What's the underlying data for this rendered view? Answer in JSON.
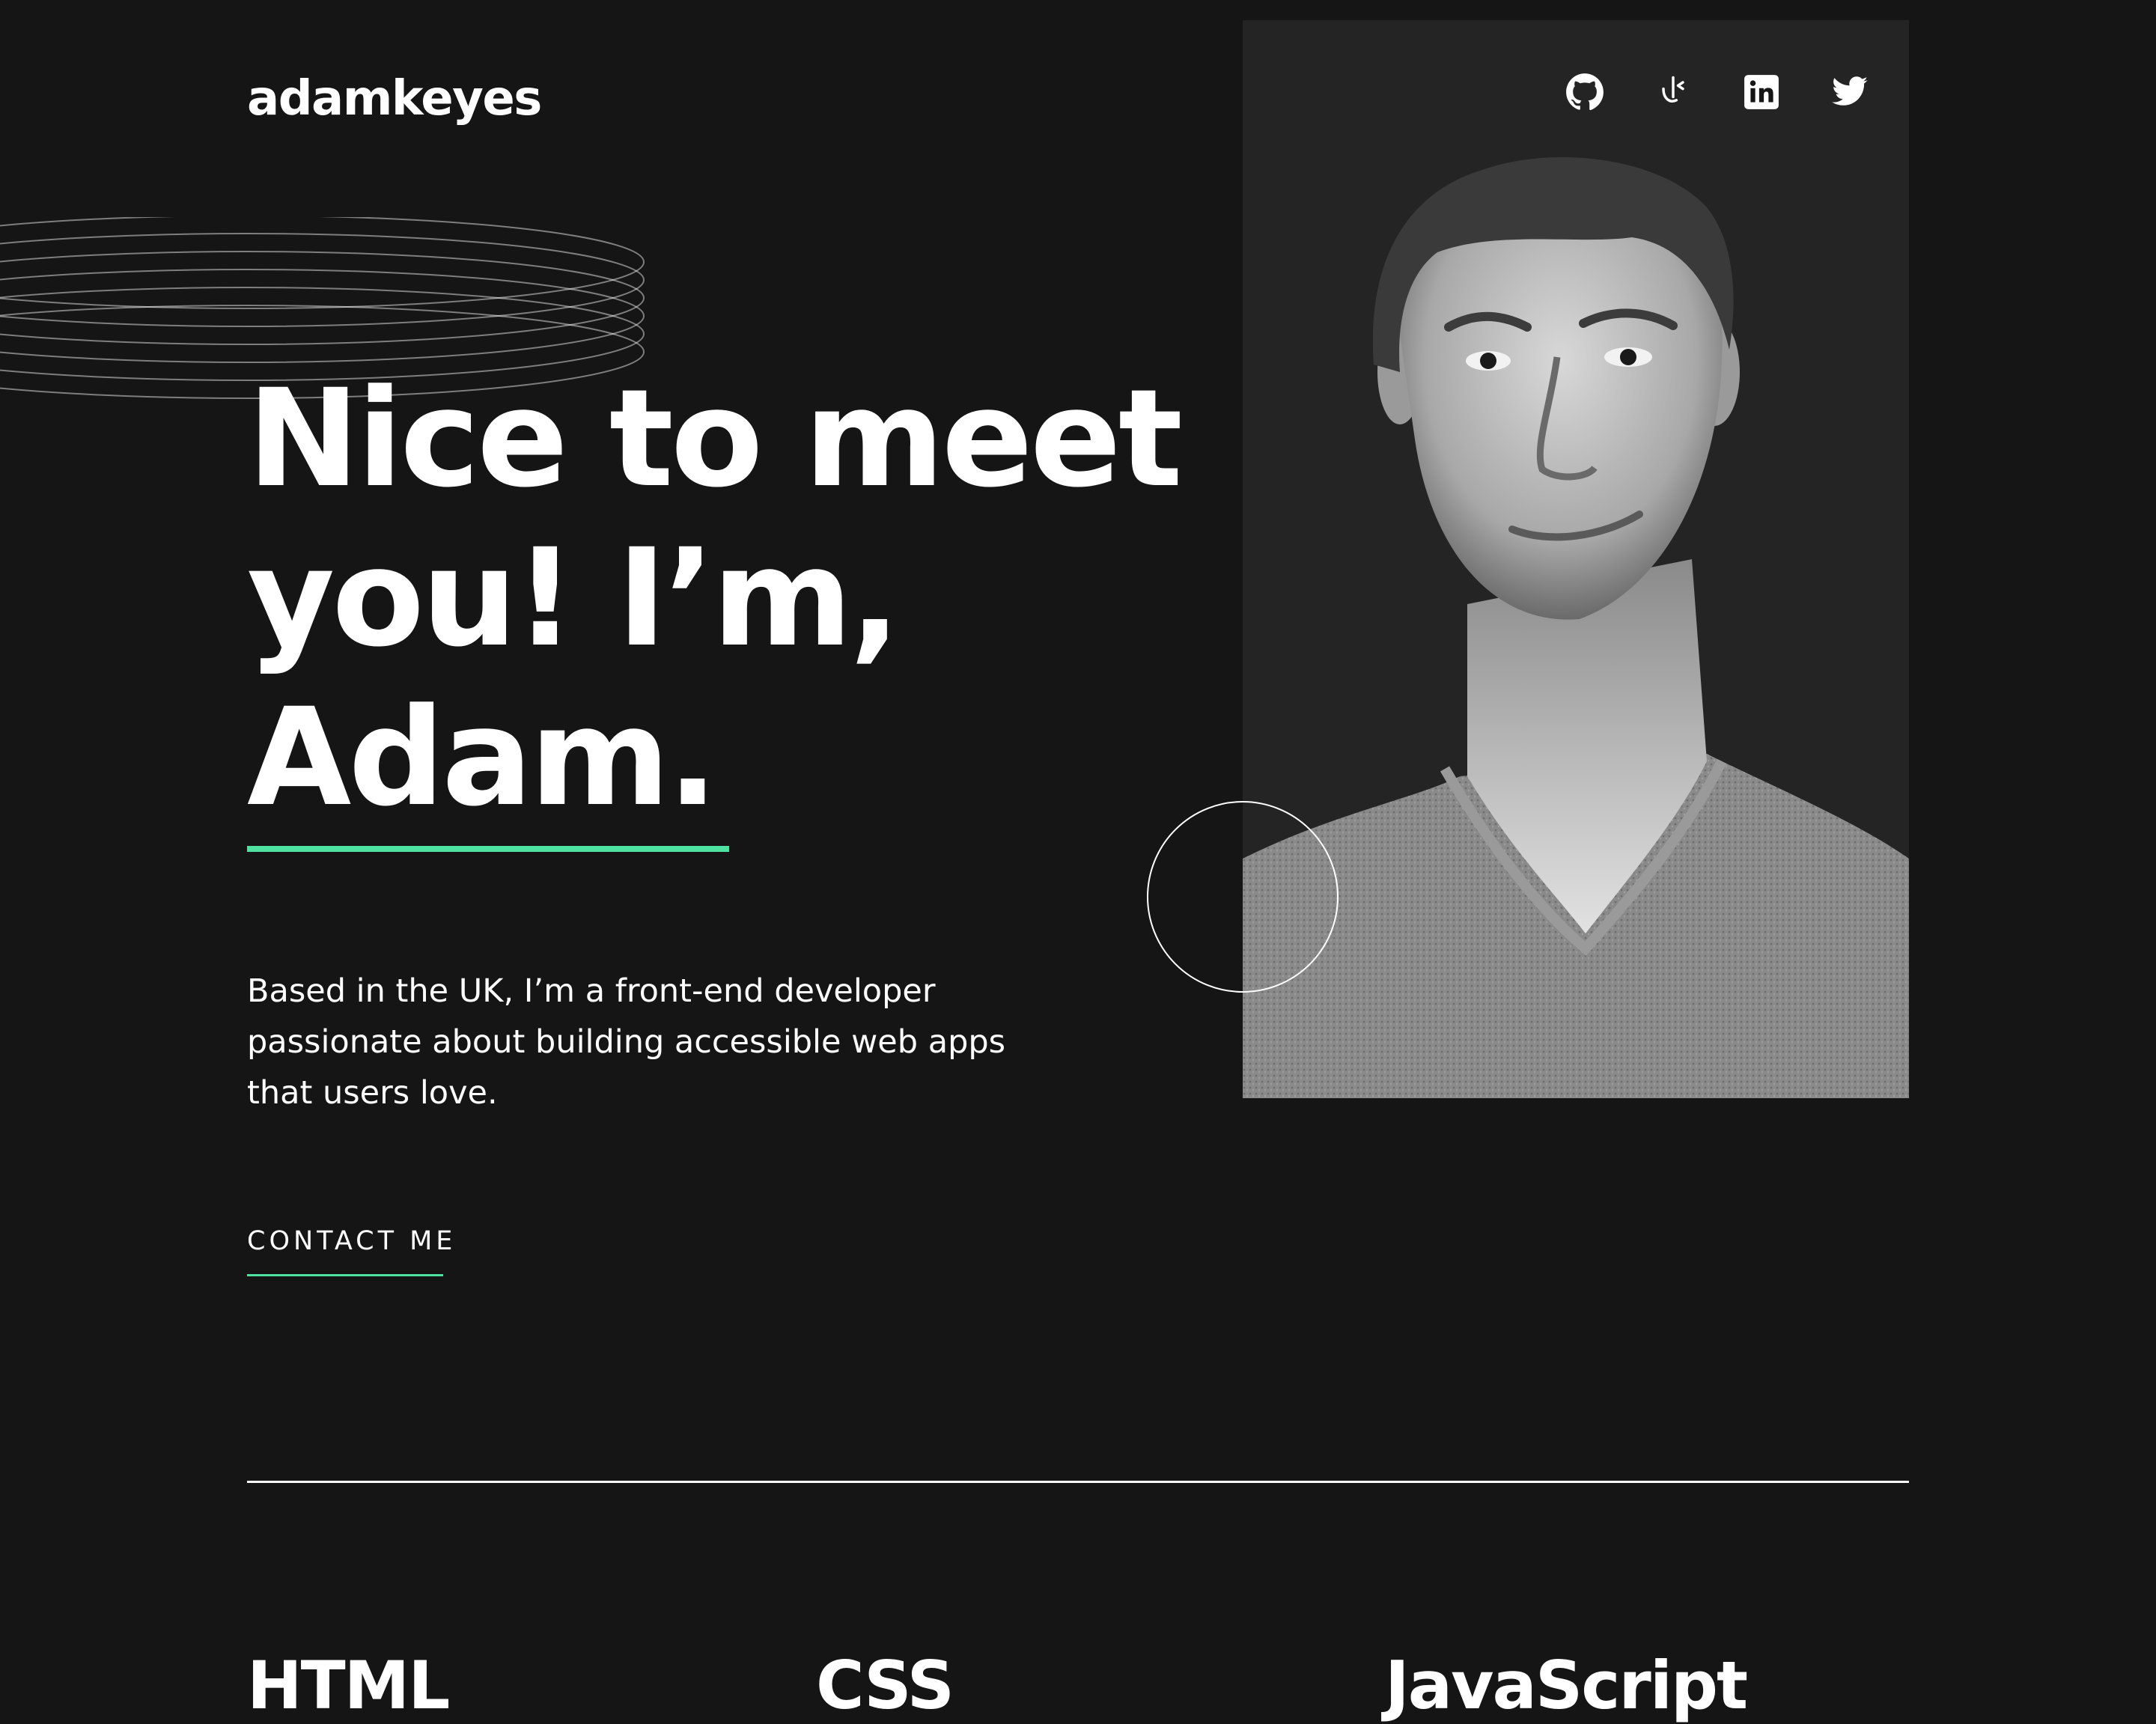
{
  "header": {
    "logo": "adamkeyes",
    "socials": [
      {
        "name": "GitHub",
        "icon": "github-icon"
      },
      {
        "name": "Frontend Mentor",
        "icon": "frontend-mentor-icon"
      },
      {
        "name": "LinkedIn",
        "icon": "linkedin-icon"
      },
      {
        "name": "Twitter",
        "icon": "twitter-icon"
      }
    ]
  },
  "hero": {
    "headline_lines": [
      "Nice to meet",
      "you! I’m,",
      "Adam."
    ],
    "intro": "Based in the UK, I’m a front-end developer passionate about building accessible web apps that users love.",
    "cta_label": "CONTACT ME",
    "photo_icon": "portrait-photo"
  },
  "skills": [
    {
      "name": "HTML"
    },
    {
      "name": "CSS"
    },
    {
      "name": "JavaScript"
    }
  ],
  "colors": {
    "background": "#151515",
    "panel": "#242424",
    "accent": "#4ee1a0",
    "text": "#ffffff"
  }
}
